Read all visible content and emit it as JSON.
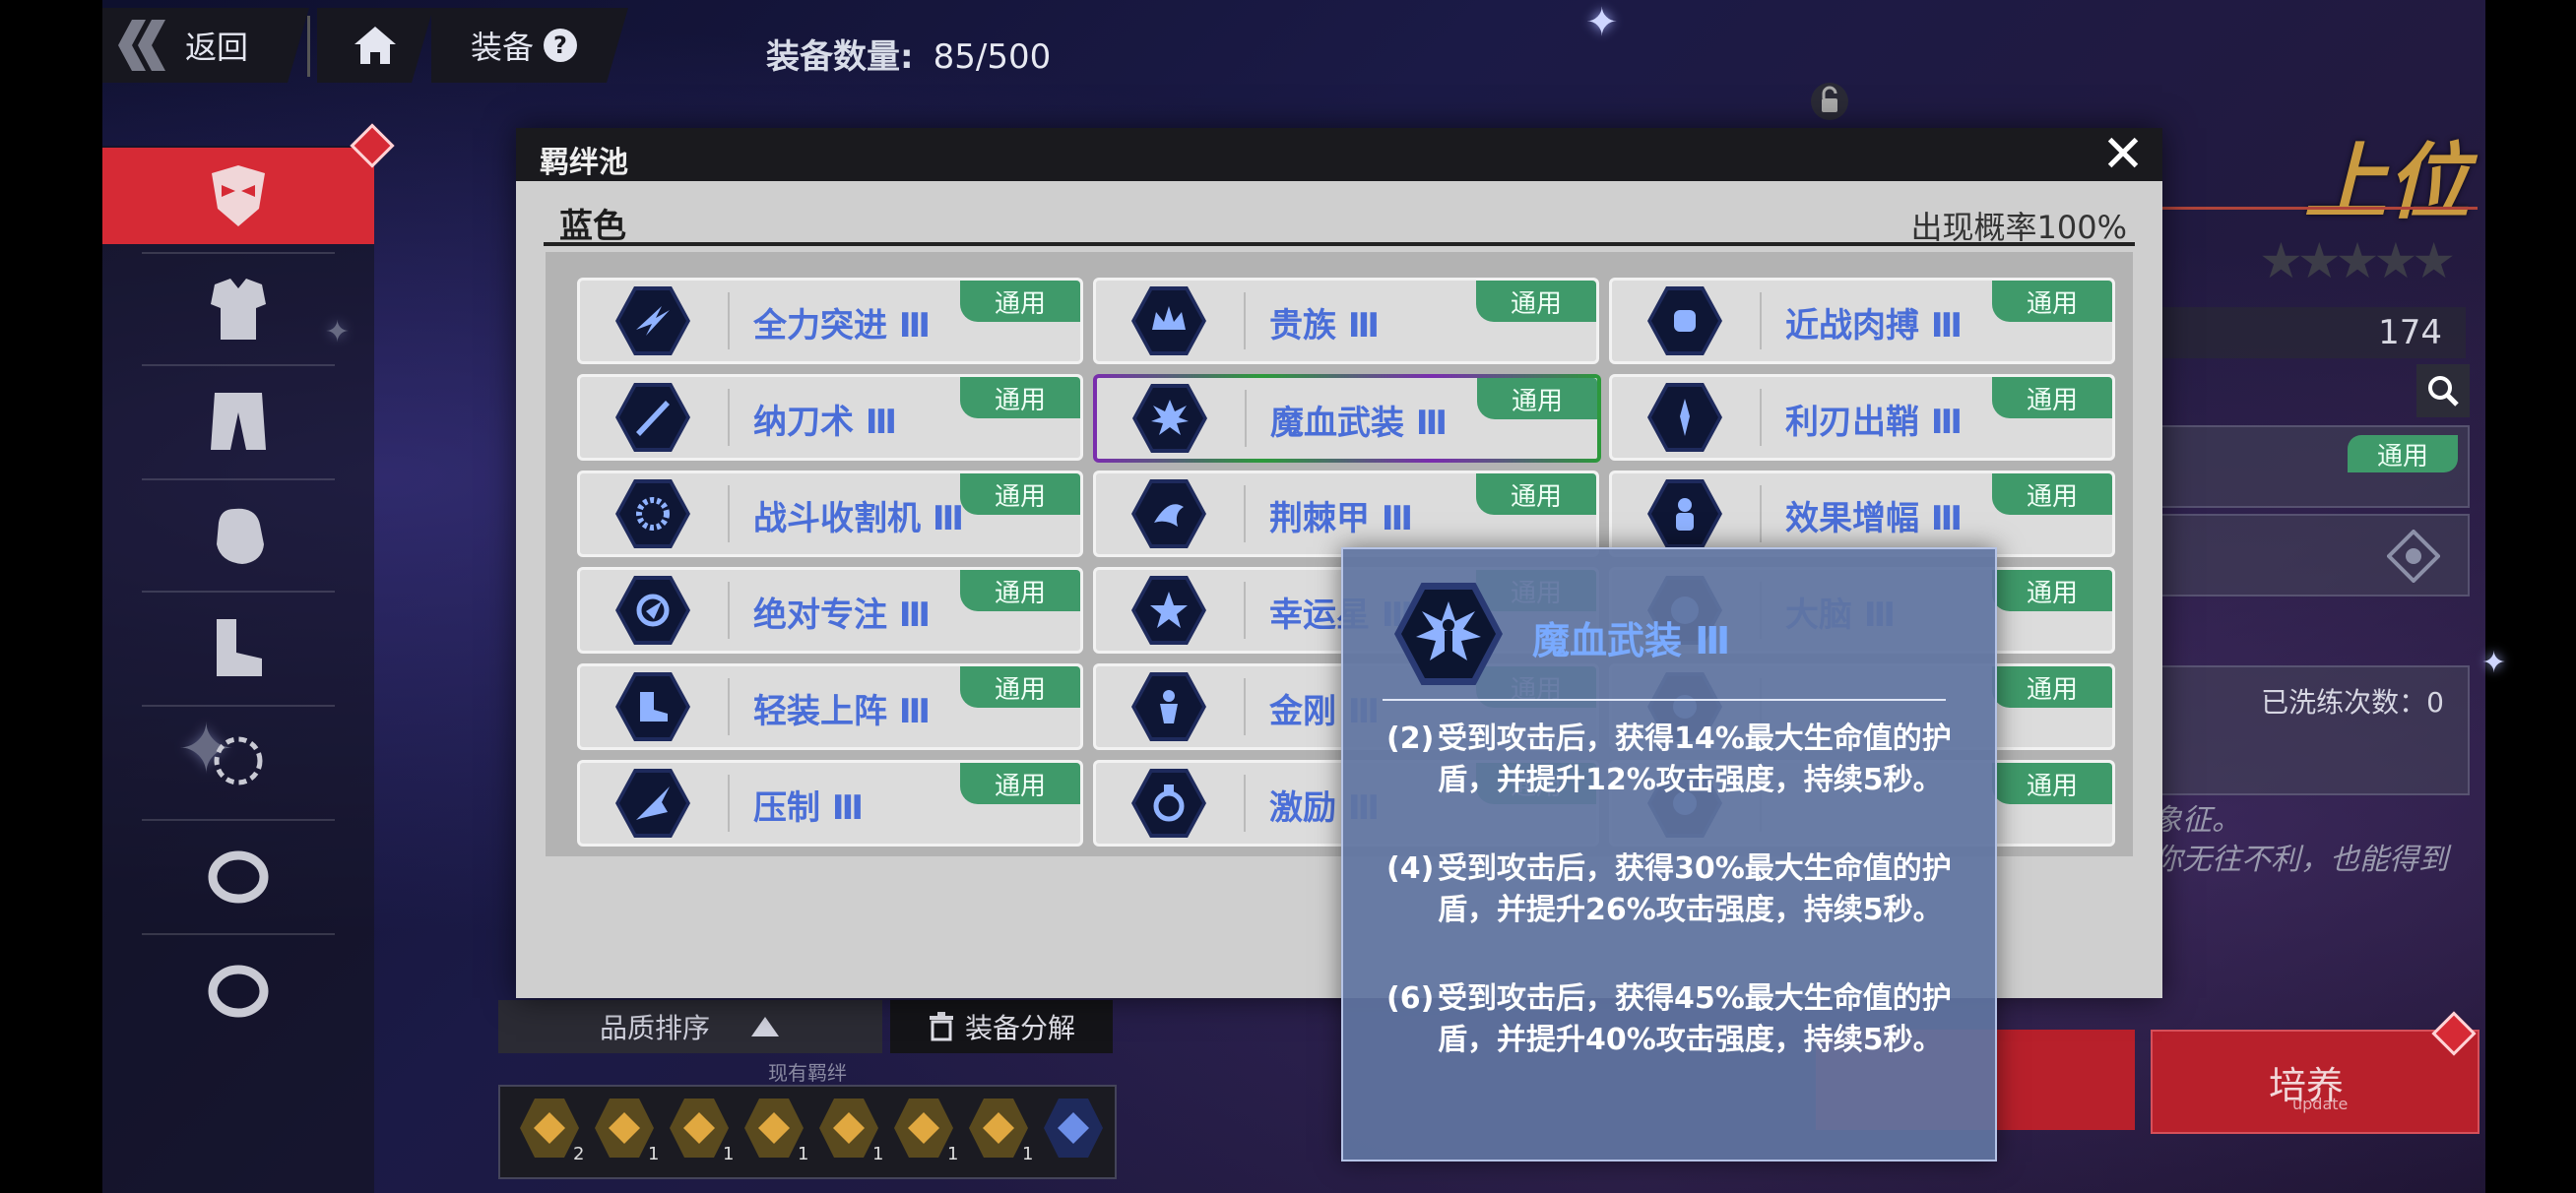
{
  "topbar": {
    "back_label": "返回",
    "equip_label": "装备",
    "equip_count_label": "装备数量:",
    "equip_count_value": "85/500"
  },
  "sidebar": {
    "items": [
      "mask-icon",
      "armor-icon",
      "pants-icon",
      "glove-icon",
      "boots-icon",
      "necklace-icon",
      "ring-icon",
      "ring-icon"
    ]
  },
  "right_panel": {
    "rank_title": "上位",
    "stars": 5,
    "value": "174",
    "general_badge": "通用",
    "wash_count": "已洗练次数：0",
    "desc_line1": "象征。",
    "desc_line2": "你无往不利，也能得到",
    "cultivate_label": "培养",
    "cultivate_sub": "update"
  },
  "modal": {
    "title": "羁绊池",
    "section": "蓝色",
    "probability": "出现概率100%",
    "badge": "通用",
    "cards": [
      {
        "name": "全力突进 Ⅲ",
        "icon": "dash-icon"
      },
      {
        "name": "贵族 Ⅲ",
        "icon": "crown-icon"
      },
      {
        "name": "近战肉搏 Ⅲ",
        "icon": "fist-icon"
      },
      {
        "name": "纳刀术 Ⅲ",
        "icon": "sword-sheath-icon"
      },
      {
        "name": "魔血武装 Ⅲ",
        "icon": "blood-armor-icon"
      },
      {
        "name": "利刃出鞘 Ⅲ",
        "icon": "blade-icon"
      },
      {
        "name": "战斗收割机 Ⅲ",
        "icon": "saw-icon"
      },
      {
        "name": "荆棘甲 Ⅲ",
        "icon": "thorn-icon"
      },
      {
        "name": "效果增幅 Ⅲ",
        "icon": "amplify-icon"
      },
      {
        "name": "绝对专注 Ⅲ",
        "icon": "focus-icon"
      },
      {
        "name": "幸运星 Ⅲ",
        "icon": "star-icon"
      },
      {
        "name": "大脑 Ⅲ",
        "icon": "brain-icon"
      },
      {
        "name": "轻装上阵 Ⅲ",
        "icon": "boot-icon"
      },
      {
        "name": "金刚 Ⅲ",
        "icon": "guardian-icon"
      },
      {
        "name": "",
        "icon": "unknown-icon"
      },
      {
        "name": "压制 Ⅲ",
        "icon": "suppress-icon"
      },
      {
        "name": "激励 Ⅲ",
        "icon": "medal-icon"
      },
      {
        "name": "",
        "icon": "unknown-icon"
      }
    ]
  },
  "bottom": {
    "quality_sort": "品质排序",
    "dismantle": "装备分解",
    "current_bonds": "现有羁绊",
    "bond_counts": [
      "2",
      "1",
      "1",
      "1",
      "1",
      "1",
      "1",
      ""
    ]
  },
  "tooltip": {
    "name": "魔血武装 Ⅲ",
    "effects": [
      {
        "level": "(2)",
        "text": "受到攻击后，获得14%最大生命值的护盾，并提升12%攻击强度，持续5秒。"
      },
      {
        "level": "(4)",
        "text": "受到攻击后，获得30%最大生命值的护盾，并提升26%攻击强度，持续5秒。"
      },
      {
        "level": "(6)",
        "text": "受到攻击后，获得45%最大生命值的护盾，并提升40%攻击强度，持续5秒。"
      }
    ]
  },
  "colors": {
    "accent_red": "#d62a35",
    "badge_green": "#3f9a6a",
    "bond_blue": "#4a6ed8",
    "rank_gold": "#c99a40"
  }
}
